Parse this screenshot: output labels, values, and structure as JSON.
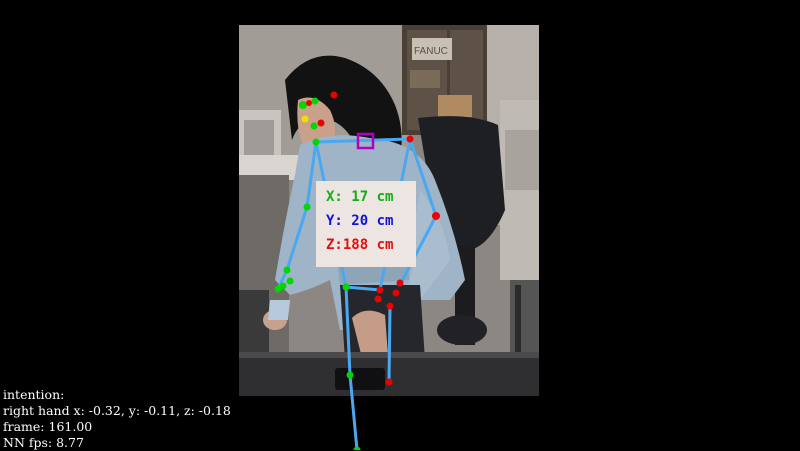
{
  "scene": {
    "background_box_label": "FANUC"
  },
  "position_readout": {
    "x_text": "X: 17 cm",
    "y_text": "Y: 20 cm",
    "z_text": "Z:188 cm",
    "x_color": "#0fae12",
    "y_color": "#1212dd",
    "z_color": "#e01010"
  },
  "hud": {
    "intention": "intention:",
    "right_hand": "right hand x: -0.32, y: -0.11, z: -0.18",
    "frame": "frame: 161.00",
    "nn_fps": "NN fps: 8.77"
  },
  "colors": {
    "skeleton_line": "#4aa8f0",
    "left_joint": "#00d800",
    "right_joint": "#ee0000",
    "eye_joint": "#f0e000",
    "neck_marker": "#b000c0"
  }
}
